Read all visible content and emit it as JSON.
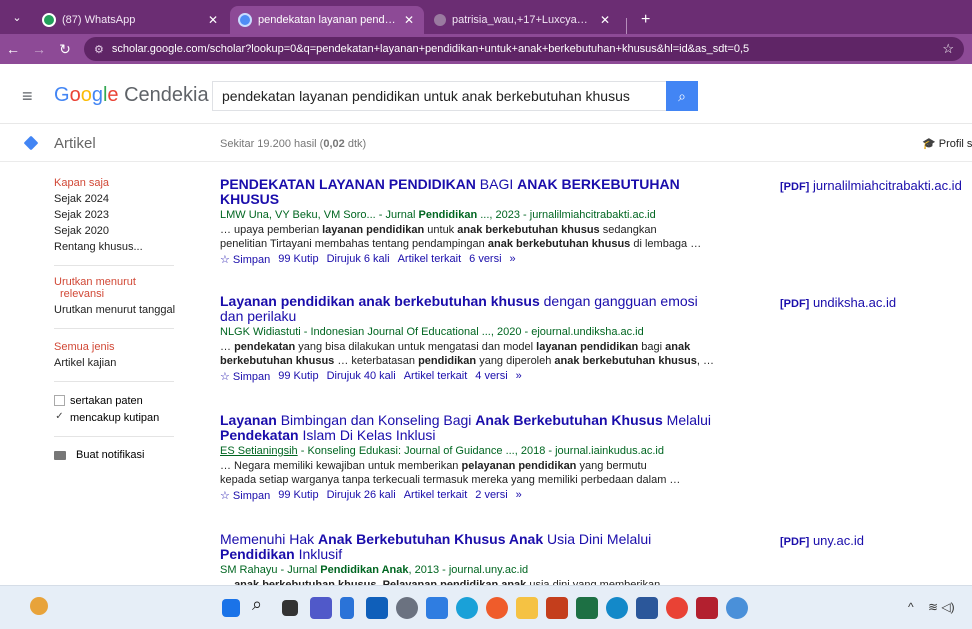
{
  "browser": {
    "tabs": [
      {
        "title": "(87) WhatsApp",
        "icon": "whatsapp-icon"
      },
      {
        "title": "pendekatan layanan pendidika",
        "icon": "scholar-icon",
        "active": true
      },
      {
        "title": "patrisia_wau,+17+Luxcya+Mart",
        "icon": "page-icon"
      }
    ],
    "url": "scholar.google.com/scholar?lookup=0&q=pendekatan+layanan+pendidikan+untuk+anak+berkebutuhan+khusus&hl=id&as_sdt=0,5"
  },
  "header": {
    "logo_google": "Google",
    "logo_product": "Cendekia",
    "query": "pendekatan layanan pendidikan untuk anak berkebutuhan khusus"
  },
  "subheader": {
    "section": "Artikel",
    "stats_prefix": "Sekitar 19.200 hasil (",
    "stats_time": "0,02",
    "stats_suffix": " dtk)",
    "profile": "Profil s"
  },
  "sidebar": {
    "time": [
      "Kapan saja",
      "Sejak 2024",
      "Sejak 2023",
      "Sejak 2020",
      "Rentang khusus..."
    ],
    "sort_relevance_1": "Urutkan menurut",
    "sort_relevance_2": "relevansi",
    "sort_date": "Urutkan menurut tanggal",
    "type_all": "Semua jenis",
    "type_review": "Artikel kajian",
    "include_patents": "sertakan paten",
    "include_citations": "mencakup kutipan",
    "alert": "Buat notifikasi"
  },
  "results": [
    {
      "authors": "LMW Una, VY Beku, VM Soro... - Jurnal ",
      "authors_b": "Pendidikan",
      "authors_end": " ..., 2023 - jurnalilmiahcitrabakti.ac.id",
      "cited": "Dirujuk 6 kali",
      "versions": "6 versi",
      "pdf_tag": "[PDF]",
      "pdf_site": "jurnalilmiahcitrabakti.ac.id"
    },
    {
      "authors": "NLGK Widiastuti - Indonesian Journal Of Educational ..., 2020 - ejournal.undiksha.ac.id",
      "cited": "Dirujuk 40 kali",
      "versions": "4 versi",
      "pdf_tag": "[PDF]",
      "pdf_site": "undiksha.ac.id"
    },
    {
      "authors_u": "ES Setianingsih",
      "authors": " - Konseling Edukasi: Journal of Guidance ..., 2018 - journal.iainkudus.ac.id",
      "cited": "Dirujuk 26 kali",
      "versions": "2 versi"
    },
    {
      "authors": "SM Rahayu - Jurnal ",
      "authors_b": "Pendidikan Anak",
      "authors_end": ", 2013 - journal.uny.ac.id",
      "pdf_tag": "[PDF]",
      "pdf_site": "uny.ac.id"
    }
  ],
  "links": {
    "save": "Simpan",
    "cite": "Kutip",
    "related": "Artikel terkait"
  },
  "colors": {
    "tabbar": "#6b2d73",
    "addressbar": "#8d4a96",
    "link": "#1a0dab",
    "green": "#006621",
    "red": "#d14836",
    "accent": "#4285f4"
  }
}
